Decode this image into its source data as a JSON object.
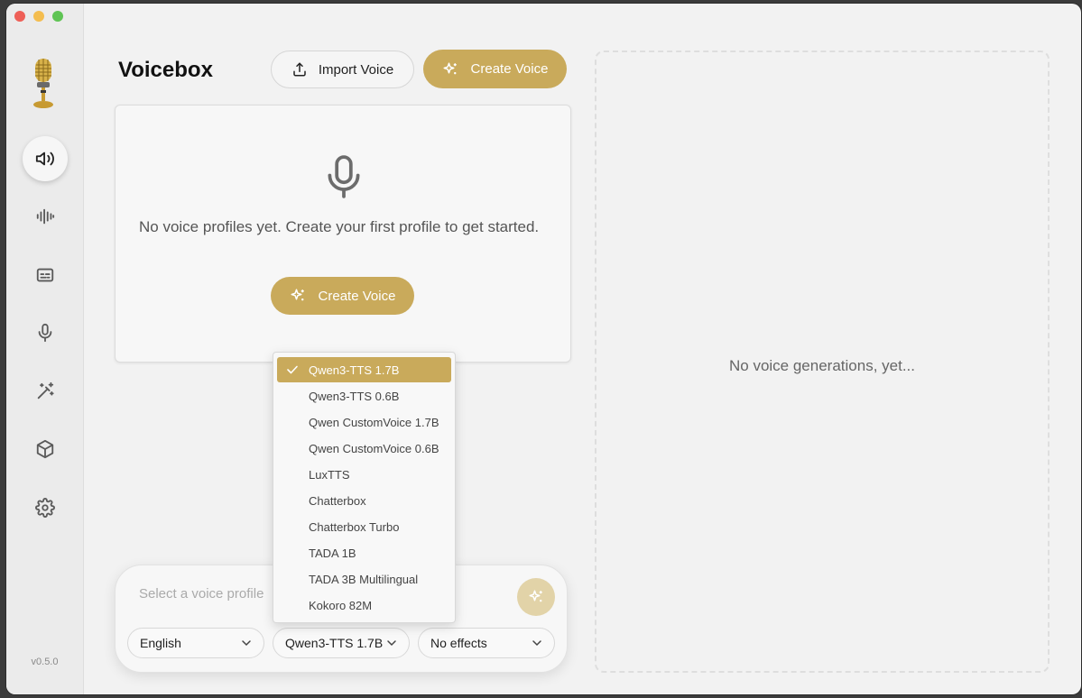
{
  "app": {
    "title": "Voicebox",
    "version": "v0.5.0"
  },
  "header": {
    "import_label": "Import Voice",
    "create_label": "Create Voice"
  },
  "empty_state": {
    "message": "No voice profiles yet. Create your first profile to get started.",
    "create_label": "Create Voice"
  },
  "history": {
    "empty_message": "No voice generations, yet..."
  },
  "sidebar": {
    "items": [
      {
        "icon": "speaker-icon",
        "active": true
      },
      {
        "icon": "waveform-icon",
        "active": false
      },
      {
        "icon": "captions-icon",
        "active": false
      },
      {
        "icon": "microphone-icon",
        "active": false
      },
      {
        "icon": "magic-wand-icon",
        "active": false
      },
      {
        "icon": "cube-icon",
        "active": false
      },
      {
        "icon": "gear-icon",
        "active": false
      }
    ]
  },
  "composer": {
    "placeholder": "Select a voice profile",
    "language": "English",
    "model": "Qwen3-TTS 1.7B",
    "effects": "No effects"
  },
  "model_dropdown": {
    "selected": "Qwen3-TTS 1.7B",
    "options": [
      "Qwen3-TTS 1.7B",
      "Qwen3-TTS 0.6B",
      "Qwen CustomVoice 1.7B",
      "Qwen CustomVoice 0.6B",
      "LuxTTS",
      "Chatterbox",
      "Chatterbox Turbo",
      "TADA 1B",
      "TADA 3B Multilingual",
      "Kokoro 82M"
    ]
  },
  "colors": {
    "accent": "#c9aa5b",
    "accent_light": "#e2d3a8",
    "background": "#f2f2f2"
  }
}
